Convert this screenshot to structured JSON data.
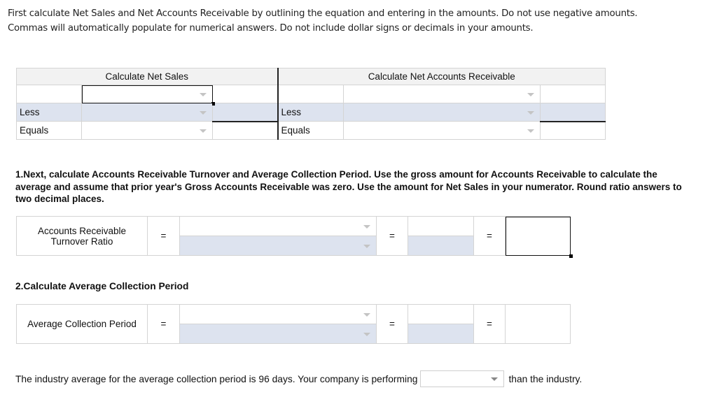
{
  "intro": {
    "line1": "First calculate Net Sales and Net Accounts Receivable by outlining the equation and entering in the amounts. Do not use negative amounts.",
    "line2": "Commas will automatically populate for numerical answers. Do not include dollar signs or decimals in your amounts."
  },
  "net_sales": {
    "header": "Calculate Net Sales",
    "rows": [
      {
        "label": "",
        "account": "",
        "amount": ""
      },
      {
        "label": "Less",
        "account": "",
        "amount": ""
      },
      {
        "label": "Equals",
        "account": "",
        "amount": ""
      }
    ]
  },
  "net_ar": {
    "header": "Calculate Net Accounts Receivable",
    "rows": [
      {
        "label": "",
        "account": "",
        "amount": ""
      },
      {
        "label": "Less",
        "account": "",
        "amount": ""
      },
      {
        "label": "Equals",
        "account": "",
        "amount": ""
      }
    ]
  },
  "question1": {
    "text": "1.Next, calculate Accounts Receivable Turnover and Average Collection Period. Use the gross amount for Accounts Receivable to calculate the average and assume that prior year's Gross Accounts Receivable was zero. Use the amount for Net Sales in your numerator. Round ratio answers to two decimal places."
  },
  "ar_turnover": {
    "label": "Accounts Receivable Turnover Ratio",
    "eq": "=",
    "numerator_select": "",
    "denominator_select": "",
    "numerator_value": "",
    "denominator_value": "",
    "answer": ""
  },
  "question2": {
    "text": "2.Calculate Average Collection Period"
  },
  "avg_collection": {
    "label": "Average Collection Period",
    "eq": "=",
    "numerator_select": "",
    "denominator_select": "",
    "numerator_value": "",
    "denominator_value": "",
    "answer": ""
  },
  "conclusion": {
    "before": "The industry average for the average collection period is 96 days. Your company is performing",
    "selected": "",
    "after": "than the industry."
  }
}
